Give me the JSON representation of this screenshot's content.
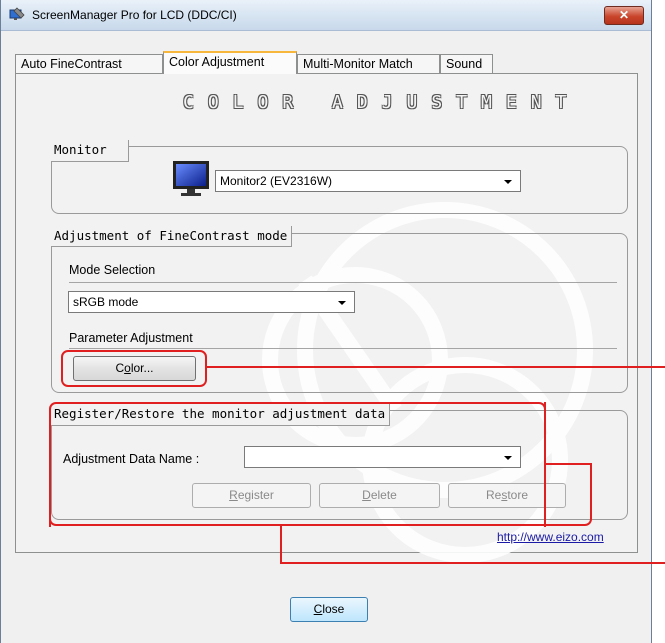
{
  "window": {
    "title": "ScreenManager Pro for LCD (DDC/CI)",
    "close_glyph": "✕"
  },
  "tabs": [
    {
      "label": "Auto FineContrast",
      "active": false
    },
    {
      "label": "Color Adjustment",
      "active": true
    },
    {
      "label": "Multi-Monitor Match",
      "active": false
    },
    {
      "label": "Sound",
      "active": false
    }
  ],
  "panel": {
    "heading": "COLOR ADJUSTMENT",
    "monitor_group": {
      "label": "Monitor",
      "selected": "Monitor2 (EV2316W)",
      "icon": "monitor-icon"
    },
    "finecontrast_group": {
      "label": "Adjustment of FineContrast mode",
      "mode_selection_label": "Mode Selection",
      "mode_selected": "sRGB mode",
      "parameter_label": "Parameter Adjustment",
      "color_button": {
        "pre": "C",
        "underlined": "o",
        "post": "lor..."
      }
    },
    "register_group": {
      "label": "Register/Restore the monitor adjustment data",
      "data_name_label": "Adjustment Data Name :",
      "data_name_value": "",
      "register_button": {
        "underlined": "R",
        "post": "egister"
      },
      "delete_button": {
        "underlined": "D",
        "post": "elete"
      },
      "restore_button": {
        "pre": "Re",
        "underlined": "s",
        "post": "tore"
      }
    },
    "link": "http://www.eizo.com"
  },
  "footer": {
    "close_button": {
      "underlined": "C",
      "post": "lose"
    }
  },
  "colors": {
    "annotation_red": "#e02020",
    "active_tab_accent": "#f6b73c",
    "link": "#1a1aa6"
  }
}
